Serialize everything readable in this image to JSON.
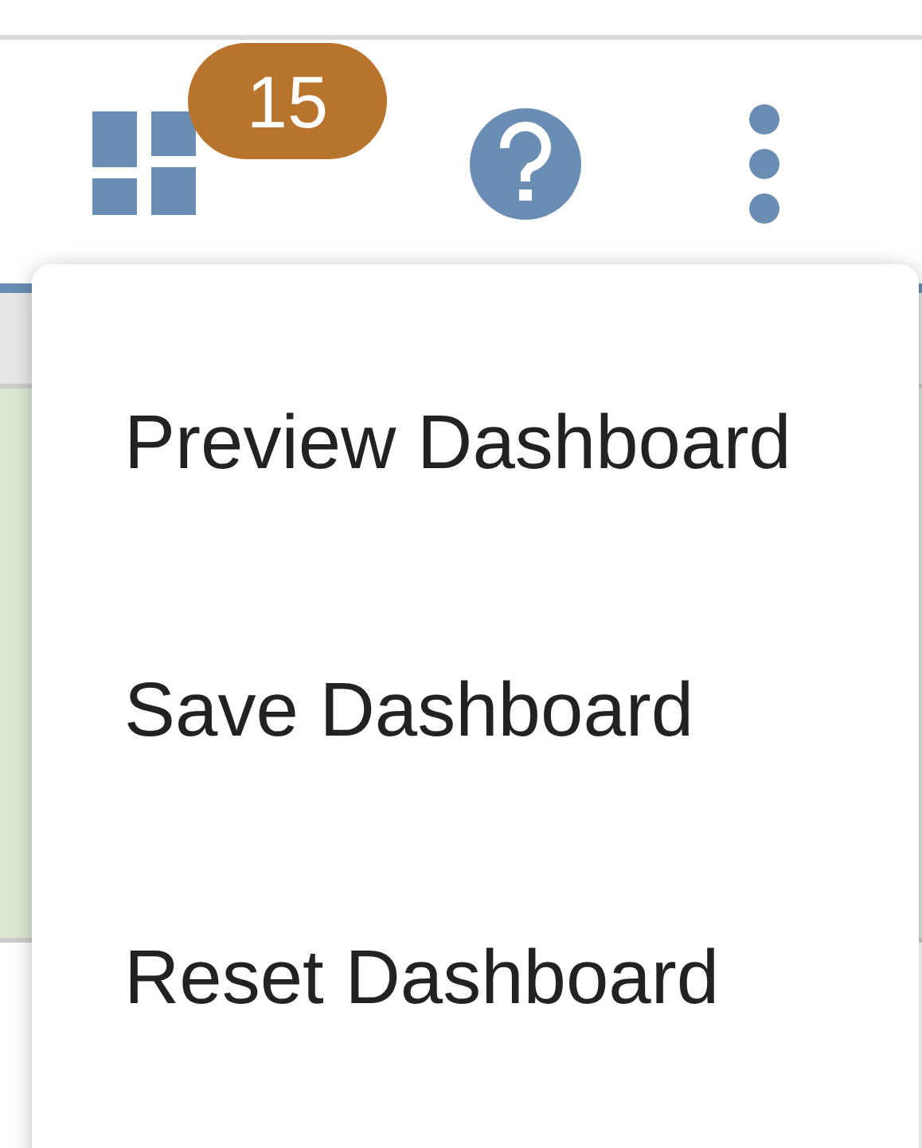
{
  "toolbar": {
    "dashboards_badge": "15"
  },
  "menu": {
    "items": [
      {
        "label": "Preview Dashboard"
      },
      {
        "label": "Save Dashboard"
      },
      {
        "label": "Reset Dashboard"
      }
    ]
  }
}
